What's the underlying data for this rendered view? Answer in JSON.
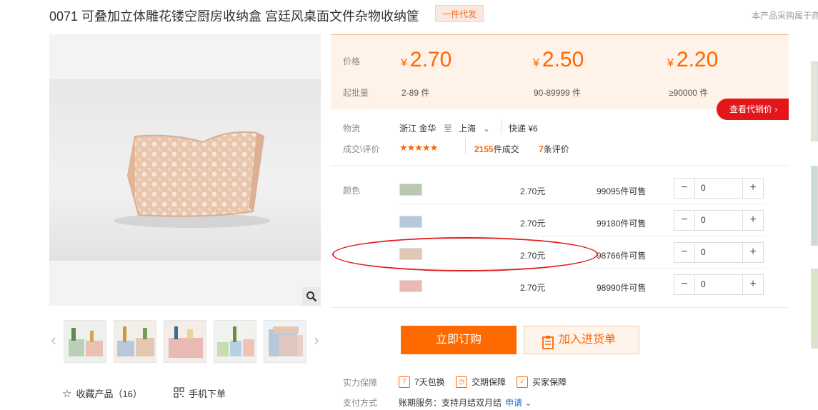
{
  "title": "0071 可叠加立体雕花镂空厨房收纳盒 宫廷风桌面文件杂物收纳筐",
  "badge": "一件代发",
  "top_right_text": "本产品采购属于商",
  "actions": {
    "favorite": "收藏产品（16）",
    "mobile": "手机下单"
  },
  "pricing": {
    "price_label": "价格",
    "min_label": "起批量",
    "currency": "¥",
    "tiers": [
      {
        "price": "2.70",
        "range": "2-89 件"
      },
      {
        "price": "2.50",
        "range": "90-89999 件"
      },
      {
        "price": "2.20",
        "range": "≥90000 件"
      }
    ],
    "dealer_button": "查看代销价"
  },
  "logistics": {
    "label": "物流",
    "from": "浙江 金华",
    "to_word": "至",
    "to": "上海",
    "delivery": "快递 ¥6"
  },
  "reviews": {
    "label": "成交\\评价",
    "stars": "★★★★★",
    "deals_count": "2155",
    "deals_text": "件成交",
    "review_count": "7",
    "review_text": "条评价"
  },
  "color_label": "颜色",
  "skus": [
    {
      "price": "2.70元",
      "stock": "99095件可售",
      "qty": "0",
      "swatch": "#b9c9b3"
    },
    {
      "price": "2.70元",
      "stock": "99180件可售",
      "qty": "0",
      "swatch": "#b7c8da"
    },
    {
      "price": "2.70元",
      "stock": "98766件可售",
      "qty": "0",
      "swatch": "#e2c7b5"
    },
    {
      "price": "2.70元",
      "stock": "98990件可售",
      "qty": "0",
      "swatch": "#e9b9b4"
    }
  ],
  "buttons": {
    "buy": "立即订购",
    "cart": "加入进货单"
  },
  "guarantee": {
    "label": "实力保障",
    "items": [
      "7天包换",
      "交期保障",
      "买家保障"
    ]
  },
  "payment": {
    "label": "支付方式",
    "text": "账期服务：支持月结双月结",
    "link": "申请"
  },
  "colors": {
    "accent": "#ff6600",
    "danger": "#e4161a",
    "price_bg": "#fff2e8"
  }
}
